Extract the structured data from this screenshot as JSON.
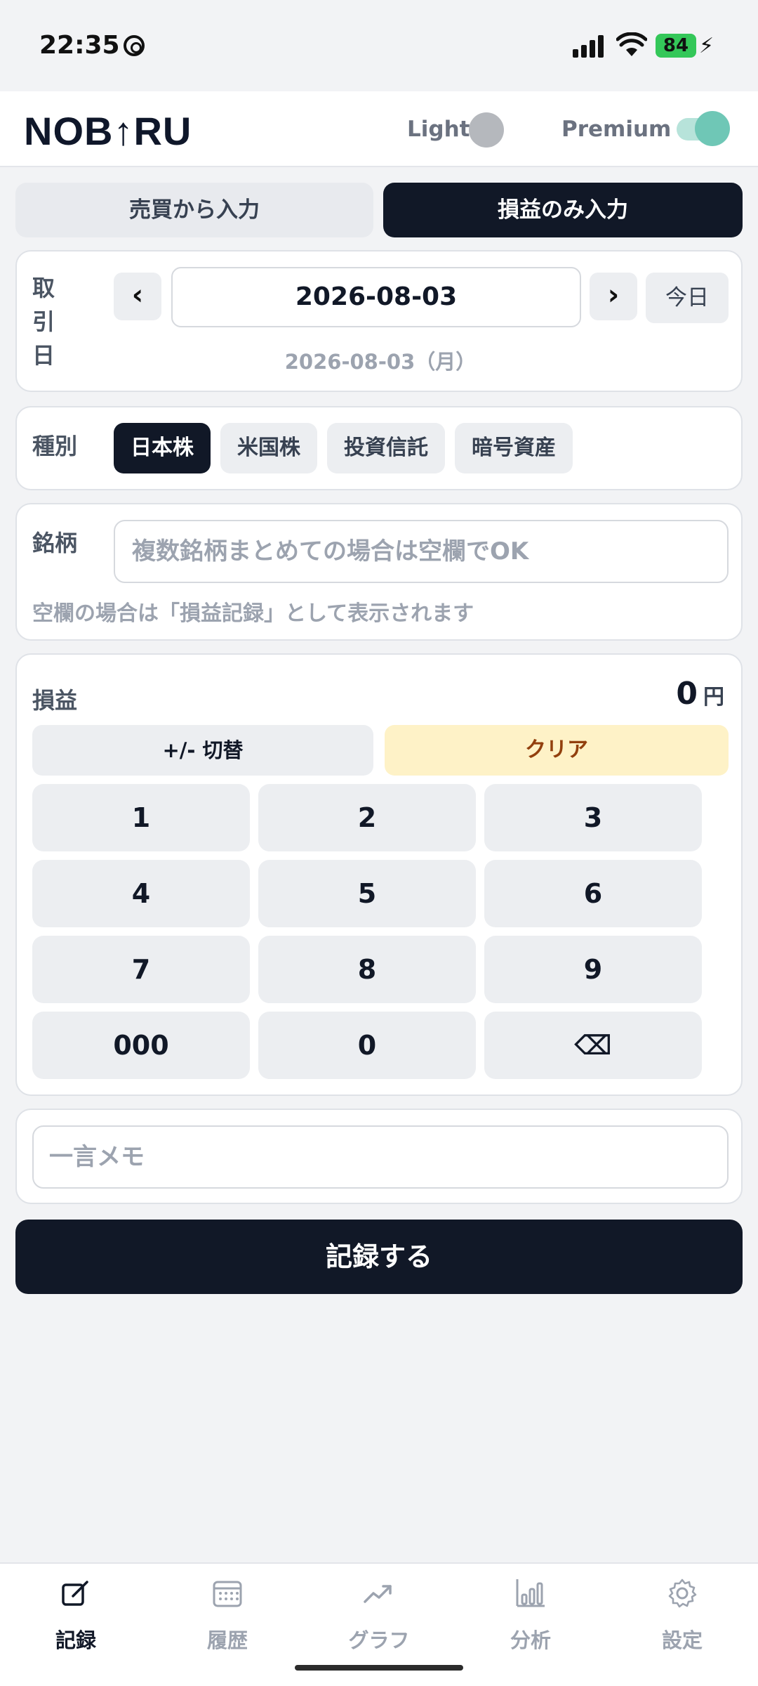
{
  "status": {
    "time": "22:35",
    "battery": "84"
  },
  "header": {
    "logo": "NOB↑RU",
    "light_label": "Light",
    "premium_label": "Premium"
  },
  "tabs": {
    "trade": "売買から入力",
    "pl_only": "損益のみ入力"
  },
  "date": {
    "label": "取引日",
    "prev": "‹",
    "next": "›",
    "value": "2026-08-03",
    "today": "今日",
    "sub": "2026-08-03（月）"
  },
  "type": {
    "label": "種別",
    "options": [
      "日本株",
      "米国株",
      "投資信託",
      "暗号資産"
    ],
    "selected": "日本株"
  },
  "symbol": {
    "label": "銘柄",
    "placeholder": "複数銘柄まとめての場合は空欄でOK",
    "help": "空欄の場合は「損益記録」として表示されます"
  },
  "pl": {
    "label": "損益",
    "amount": "0",
    "unit": "円",
    "sign_toggle": "+/- 切替",
    "clear": "クリア",
    "keys": [
      "1",
      "2",
      "3",
      "4",
      "5",
      "6",
      "7",
      "8",
      "9",
      "000",
      "0",
      "⌫"
    ]
  },
  "memo": {
    "placeholder": "一言メモ"
  },
  "record_button": "記録する",
  "nav": [
    {
      "label": "記録",
      "icon": "edit-icon",
      "active": true
    },
    {
      "label": "履歴",
      "icon": "calendar-icon",
      "active": false
    },
    {
      "label": "グラフ",
      "icon": "trend-icon",
      "active": false
    },
    {
      "label": "分析",
      "icon": "bar-chart-icon",
      "active": false
    },
    {
      "label": "設定",
      "icon": "gear-icon",
      "active": false
    }
  ],
  "colors": {
    "primary": "#111827",
    "clear_bg": "#fef2c7",
    "accent": "#6fc7b6"
  }
}
